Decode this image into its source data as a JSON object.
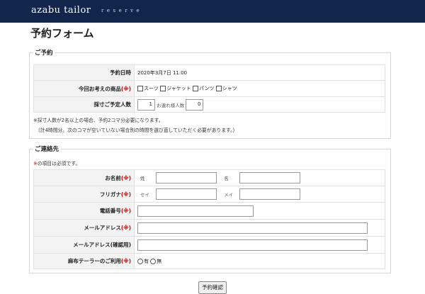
{
  "header": {
    "logo": "azabu tailor",
    "logo_sub": "reserve"
  },
  "page_title": "予約フォーム",
  "reservation": {
    "legend": "ご予約",
    "date": {
      "label": "予約日時",
      "value": "2020年3月7日 11:00"
    },
    "products": {
      "label": "今回お考えの商品",
      "required_mark": "(※)",
      "options": [
        "スーツ",
        "ジャケット",
        "パンツ",
        "シャツ"
      ]
    },
    "people": {
      "label": "採寸ご予定人数",
      "value": "1",
      "companions_label": "お連れ様人数",
      "companions_value": "0"
    },
    "note_line1": "※採寸人数が2名以上の場合、予約2コマ分必要になります。",
    "note_line2": "（計4時間分。次のコマが空いていない場合別の時間を選び直していただく必要があります。）"
  },
  "contact": {
    "legend": "ご連絡先",
    "required_note_mark": "※",
    "required_note_text": "の項目は必須です。",
    "name": {
      "label": "お名前",
      "required_mark": "(※)",
      "last_label": "姓",
      "first_label": "名"
    },
    "kana": {
      "label": "フリガナ",
      "required_mark": "(※)",
      "last_label": "セイ",
      "first_label": "メイ"
    },
    "phone": {
      "label": "電話番号",
      "required_mark": "(※)"
    },
    "email": {
      "label": "メールアドレス",
      "required_mark": "(※)"
    },
    "email_confirm": {
      "label": "メールアドレス(確認用)"
    },
    "usage": {
      "label": "麻布テーラーのご利用",
      "required_mark": "(※)",
      "options": [
        "有",
        "無"
      ]
    }
  },
  "submit_label": "予約確認"
}
